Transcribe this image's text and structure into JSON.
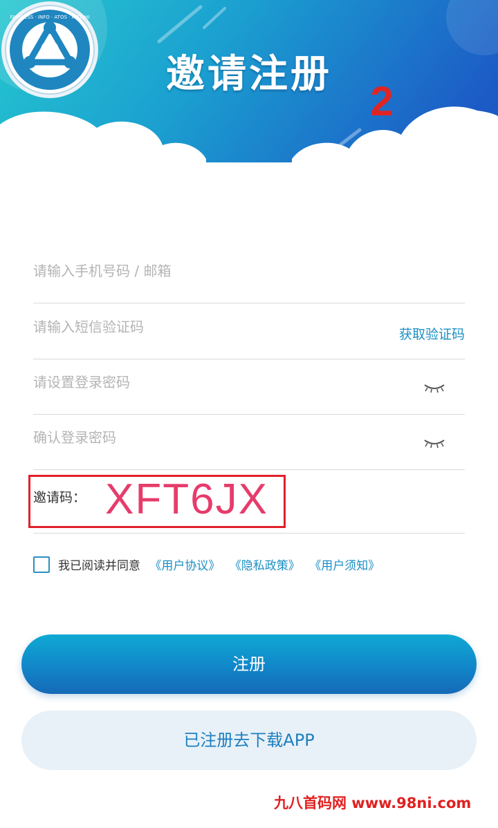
{
  "header": {
    "title": "邀请注册",
    "step_number": "2",
    "logo_ring_text": "FAIRNESS · INFO · ATOS · ATOSHI"
  },
  "form": {
    "phone_placeholder": "请输入手机号码 / 邮箱",
    "sms_placeholder": "请输入短信验证码",
    "get_code_label": "获取验证码",
    "password_placeholder": "请设置登录密码",
    "confirm_placeholder": "确认登录密码",
    "invite_label": "邀请码：",
    "invite_code": "XFT6JX"
  },
  "agreement": {
    "prefix": "我已阅读并同意",
    "links": [
      "《用户协议》",
      "《隐私政策》",
      "《用户须知》"
    ]
  },
  "buttons": {
    "register": "注册",
    "download": "已注册去下载APP"
  },
  "watermark": "九八首码网 www.98ni.com",
  "colors": {
    "accent": "#1a8fc4",
    "header_start": "#1ec0d0",
    "header_end": "#1a5fc8",
    "highlight_red": "#e0202a",
    "invite_pink": "#e63c6b"
  }
}
